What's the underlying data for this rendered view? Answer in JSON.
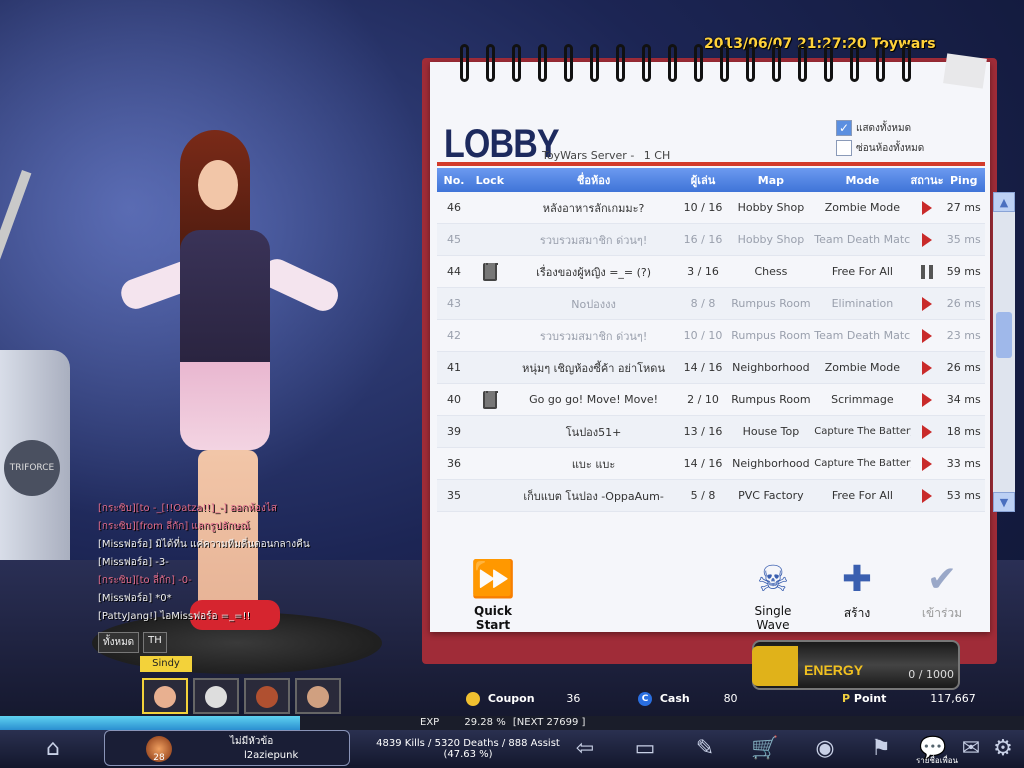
{
  "timestamp": "2013/06/07 21:27:20 Toywars",
  "lobby": {
    "title": "LOBBY",
    "server": "ToyWars Server -",
    "channel": "1 CH",
    "filters": [
      {
        "label": "แสดงทั้งหมด",
        "checked": true
      },
      {
        "label": "ซ่อนห้องทั้งหมด",
        "checked": false
      }
    ],
    "columns": [
      "No.",
      "Lock",
      "ชื่อห้อง",
      "ผู้เล่น",
      "Map",
      "Mode",
      "สถานะ",
      "Ping"
    ],
    "rooms": [
      {
        "no": "46",
        "locked": false,
        "name": "หลังอาหารลักเกมมะ?",
        "players": "10 / 16",
        "map": "Hobby Shop",
        "mode": "Zombie Mode",
        "status": "play",
        "ping": "27 ms",
        "full": false
      },
      {
        "no": "45",
        "locked": false,
        "name": "รวบรวมสมาชิก ด่วนๆ!",
        "players": "16 / 16",
        "map": "Hobby Shop",
        "mode": "Team Death Match",
        "status": "play",
        "ping": "35 ms",
        "full": true
      },
      {
        "no": "44",
        "locked": true,
        "name": "เรื่องของผู้หญิง =_= (?)",
        "players": "3 / 16",
        "map": "Chess",
        "mode": "Free For All",
        "status": "pause",
        "ping": "59 ms",
        "full": false
      },
      {
        "no": "43",
        "locked": false,
        "name": "Noปองงง",
        "players": "8 / 8",
        "map": "Rumpus Room",
        "mode": "Elimination",
        "status": "play",
        "ping": "26 ms",
        "full": true
      },
      {
        "no": "42",
        "locked": false,
        "name": "รวบรวมสมาชิก ด่วนๆ!",
        "players": "10 / 10",
        "map": "Rumpus Room",
        "mode": "Team Death Match",
        "status": "play",
        "ping": "23 ms",
        "full": true
      },
      {
        "no": "41",
        "locked": false,
        "name": "หนุ่มๆ เชิญห้องซี้ค้า อย่าโหดน",
        "players": "14 / 16",
        "map": "Neighborhood",
        "mode": "Zombie Mode",
        "status": "play",
        "ping": "26 ms",
        "full": false
      },
      {
        "no": "40",
        "locked": true,
        "name": "Go go go! Move! Move!",
        "players": "2 / 10",
        "map": "Rumpus Room",
        "mode": "Scrimmage",
        "status": "play",
        "ping": "34 ms",
        "full": false
      },
      {
        "no": "39",
        "locked": false,
        "name": "โนปอง51+",
        "players": "13 / 16",
        "map": "House Top",
        "mode": "Capture The Battery",
        "status": "play",
        "ping": "18 ms",
        "full": false
      },
      {
        "no": "36",
        "locked": false,
        "name": "แบะ แบะ",
        "players": "14 / 16",
        "map": "Neighborhood",
        "mode": "Capture The Battery",
        "status": "play",
        "ping": "33 ms",
        "full": false
      },
      {
        "no": "35",
        "locked": false,
        "name": "เก็บแบต โนปอง -OppaAum-",
        "players": "5 / 8",
        "map": "PVC Factory",
        "mode": "Free For All",
        "status": "play",
        "ping": "53 ms",
        "full": false
      }
    ],
    "actions": {
      "quick_start": "Quick Start",
      "single_wave": "Single Wave",
      "create": "สร้าง",
      "join": "เข้าร่วม"
    }
  },
  "energy": {
    "label": "ENERGY",
    "current": "0",
    "max": "1000",
    "display": "0 /  1000"
  },
  "currency": {
    "coupon_label": "Coupon",
    "coupon_value": "36",
    "cash_label": "Cash",
    "cash_value": "80",
    "point_label": "Point",
    "point_value": "117,667"
  },
  "chat": {
    "lines": [
      {
        "text": "[กระซิบ][to -_[!!Oatza!!]_-] ออกห้องไส",
        "type": "whisper"
      },
      {
        "text": "[กระซิบ][from ลี่กัก] แลกรูปลักษณ์",
        "type": "whisper"
      },
      {
        "text": "[Missฟอร์อ]  มิได้ที่น แค่ความทีมดี่นตอนกลางคืน",
        "type": "normal"
      },
      {
        "text": "[Missฟอร์อ]  -3-",
        "type": "normal"
      },
      {
        "text": "[กระซิบ][to ลี่กัก]  -0-",
        "type": "whisper"
      },
      {
        "text": "[Missฟอร์อ]  *0*",
        "type": "normal"
      },
      {
        "text": "[PattyJang!]  ไอMissฟอร์อ =_=!!",
        "type": "normal"
      }
    ],
    "tabs": [
      "ทั้งหมด",
      "TH"
    ]
  },
  "character": {
    "name": "Sindy"
  },
  "exp": {
    "label": "EXP",
    "percent": "29.28 %",
    "next": "[NEXT   27699 ]",
    "fill_fraction": 0.2928
  },
  "player": {
    "level": "28",
    "title": "ไม่มีหัวข้อ",
    "name": "l2aziepunk",
    "stats_line1": "4839 Kills / 5320 Deaths / 888 Assist",
    "stats_line2": "(47.63 %)"
  },
  "bottom_bar": {
    "chat_label": "รายชื่อเพื่อน"
  }
}
